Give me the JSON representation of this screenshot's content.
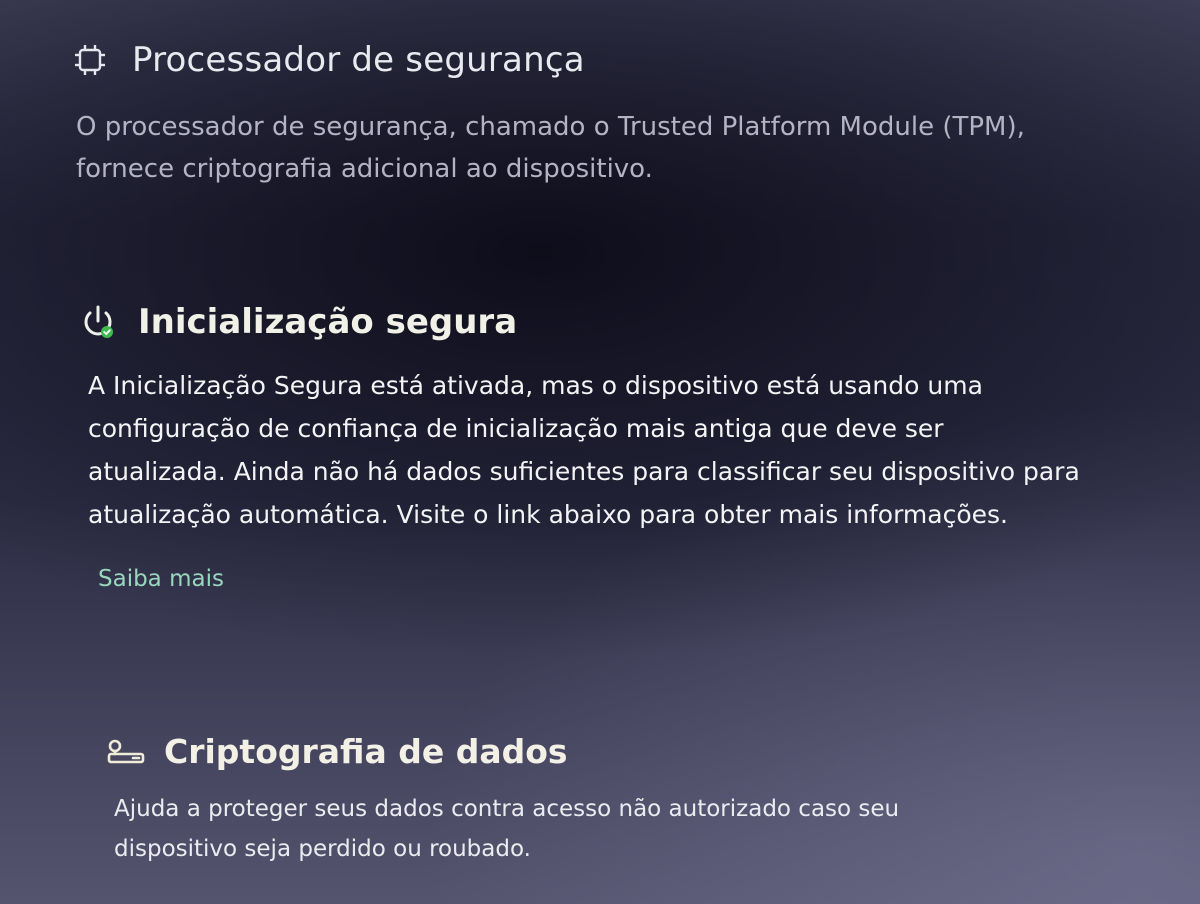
{
  "sections": {
    "processor": {
      "icon": "chip-icon",
      "title": "Processador de segurança",
      "description": "O processador de segurança, chamado o Trusted Platform Module (TPM), fornece criptografia adicional ao dispositivo."
    },
    "secure_boot": {
      "icon": "power-status-icon",
      "title": "Inicialização segura",
      "description": "A Inicialização Segura está ativada, mas o dispositivo está usando uma configuração de confiança de inicialização mais antiga que deve ser atualizada. Ainda não há dados suficientes para classificar seu dispositivo para atualização automática. Visite o link abaixo para obter mais informações.",
      "link_label": "Saiba mais"
    },
    "encryption": {
      "icon": "key-icon",
      "title": "Criptografia de dados",
      "description": "Ajuda a proteger seus dados contra acesso não autorizado caso seu dispositivo seja perdido ou roubado."
    }
  },
  "colors": {
    "link": "#98d7bd",
    "status_ok": "#3fb950"
  }
}
